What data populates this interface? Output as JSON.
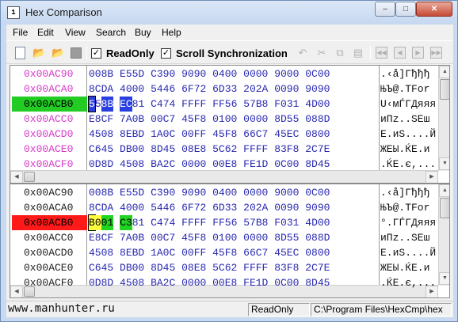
{
  "window": {
    "title": "Hex Comparison",
    "icon": "hex-app-icon",
    "minimize": "–",
    "maximize": "□",
    "close": "✕"
  },
  "menu": [
    "File",
    "Edit",
    "View",
    "Search",
    "Buy",
    "Help"
  ],
  "toolbar": {
    "readonly_label": "ReadOnly",
    "readonly_checked": true,
    "scroll_sync_label": "Scroll Synchronization",
    "scroll_sync_checked": true,
    "icons": [
      "new-file-icon",
      "open-folder-icon",
      "open-second-icon",
      "stop-icon",
      "undo-icon",
      "cut-icon",
      "copy-icon",
      "paste-icon",
      "first-diff-icon",
      "prev-diff-icon",
      "next-diff-icon",
      "last-diff-icon"
    ]
  },
  "colors": {
    "addr_magenta": "#d63ac8",
    "hex_blue": "#2828b0",
    "highlight_green": "#22cc22",
    "highlight_red": "#ff1a1a",
    "byte_blue": "#2a3fe0",
    "byte_yellow": "#ffff40"
  },
  "pane1": {
    "rows": [
      {
        "addr": "0x00AC90",
        "hex": [
          "008B",
          "E55D",
          "C390",
          "9090",
          "0400",
          "0000",
          "9000",
          "0C00"
        ],
        "ascii": ".‹å]Гђђђ"
      },
      {
        "addr": "0x00ACA0",
        "hex": [
          "8CDA",
          "4000",
          "5446",
          "6F72",
          "6D33",
          "202A",
          "0090",
          "9090"
        ],
        "ascii": "ЊЪ@.TFor"
      },
      {
        "addr": "0x00ACB0",
        "hex": [
          "558B",
          "EC81",
          "C474",
          "FFFF",
          "FF56",
          "57B8",
          "F031",
          "4D00"
        ],
        "ascii": "U‹мЃГДяяя"
      },
      {
        "addr": "0x00ACC0",
        "hex": [
          "E8CF",
          "7A0B",
          "00C7",
          "45F8",
          "0100",
          "0000",
          "8D55",
          "088D"
        ],
        "ascii": "иПz..SEш"
      },
      {
        "addr": "0x00ACD0",
        "hex": [
          "4508",
          "8EBD",
          "1A0C",
          "00FF",
          "45F8",
          "66C7",
          "45EC",
          "0800"
        ],
        "ascii": "E.иS....Й"
      },
      {
        "addr": "0x00ACE0",
        "hex": [
          "C645",
          "DB00",
          "8D45",
          "08E8",
          "5C62",
          "FFFF",
          "83F8",
          "2C7E"
        ],
        "ascii": "ЖЕЫ.ЌE.и"
      },
      {
        "addr": "0x00ACF0",
        "hex": [
          "0D8D",
          "4508",
          "BA2C",
          "0000",
          "00E8",
          "FE1D",
          "0C00",
          "8D45"
        ],
        "ascii": ".ЌE.є,..."
      }
    ]
  },
  "pane2": {
    "rows": [
      {
        "addr": "0x00AC90",
        "hex": [
          "008B",
          "E55D",
          "C390",
          "9090",
          "0400",
          "0000",
          "9000",
          "0C00"
        ],
        "ascii": ".‹å]Гђђђ"
      },
      {
        "addr": "0x00ACA0",
        "hex": [
          "8CDA",
          "4000",
          "5446",
          "6F72",
          "6D33",
          "202A",
          "0090",
          "9090"
        ],
        "ascii": "ЊЪ@.TFor"
      },
      {
        "addr": "0x00ACB0",
        "hex": [
          "B001",
          "C381",
          "C474",
          "FFFF",
          "FF56",
          "57B8",
          "F031",
          "4D00"
        ],
        "ascii": "°.ГЃГДяяя"
      },
      {
        "addr": "0x00ACC0",
        "hex": [
          "E8CF",
          "7A0B",
          "00C7",
          "45F8",
          "0100",
          "0000",
          "8D55",
          "088D"
        ],
        "ascii": "иПz..SEш"
      },
      {
        "addr": "0x00ACD0",
        "hex": [
          "4508",
          "8EBD",
          "1A0C",
          "00FF",
          "45F8",
          "66C7",
          "45EC",
          "0800"
        ],
        "ascii": "E.иS....Й"
      },
      {
        "addr": "0x00ACE0",
        "hex": [
          "C645",
          "DB00",
          "8D45",
          "08E8",
          "5C62",
          "FFFF",
          "83F8",
          "2C7E"
        ],
        "ascii": "ЖЕЫ.ЌE.и"
      },
      {
        "addr": "0x00ACF0",
        "hex": [
          "0D8D",
          "4508",
          "BA2C",
          "0000",
          "00E8",
          "FE1D",
          "0C00",
          "8D45"
        ],
        "ascii": ".ЌE.є,..."
      }
    ]
  },
  "status": {
    "site": "www.manhunter.ru",
    "mode": "ReadOnly",
    "path": "C:\\Program Files\\HexCmp\\hex"
  }
}
